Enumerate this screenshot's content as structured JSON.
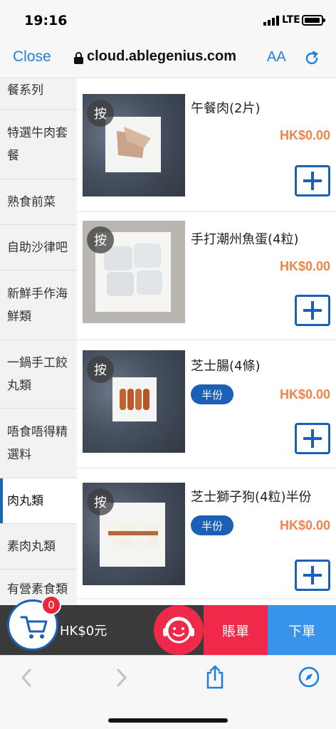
{
  "status": {
    "time": "19:16",
    "network": "LTE"
  },
  "browser": {
    "close_label": "Close",
    "url": "cloud.ablegenius.com",
    "text_size_label": "AA"
  },
  "sidebar": {
    "items": [
      {
        "label": "餐系列"
      },
      {
        "label": "特選牛肉套餐"
      },
      {
        "label": "熟食前菜"
      },
      {
        "label": "自助沙律吧"
      },
      {
        "label": "新鮮手作海鮮類"
      },
      {
        "label": "一鍋手工餃丸類"
      },
      {
        "label": "唔食唔得精選料"
      },
      {
        "label": "肉丸類"
      },
      {
        "label": "素肉丸類"
      },
      {
        "label": "有營素食類"
      }
    ]
  },
  "products": [
    {
      "badge": "按",
      "name": "午餐肉(2片)",
      "price": "HK$0.00"
    },
    {
      "badge": "按",
      "name": "手打潮州魚蛋(4粒)",
      "price": "HK$0.00"
    },
    {
      "badge": "按",
      "name": "芝士腸(4條)",
      "price": "HK$0.00",
      "tag": "半份"
    },
    {
      "badge": "按",
      "name": "芝士獅子狗(4粒)半份",
      "price": "HK$0.00",
      "tag": "半份"
    }
  ],
  "cart": {
    "count": "0",
    "total": "HK$0元"
  },
  "actions": {
    "bill_label": "賬單",
    "order_label": "下單"
  },
  "colors": {
    "accent": "#1b60b5",
    "price": "#f2834b",
    "bill": "#f0294a",
    "order": "#3893ea",
    "link": "#1e7ee0"
  }
}
